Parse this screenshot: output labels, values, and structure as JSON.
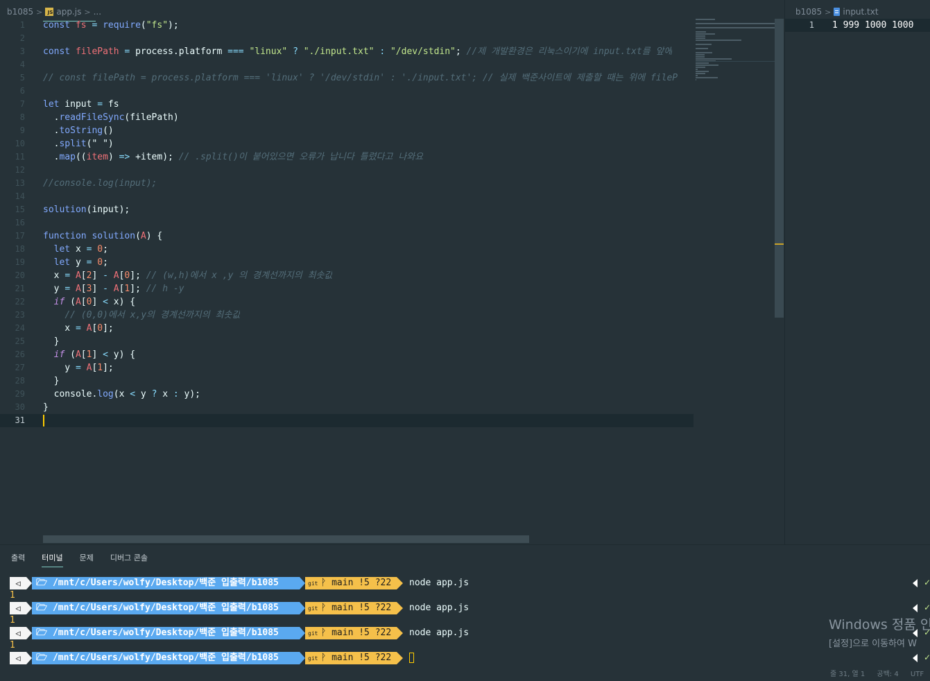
{
  "left_editor": {
    "breadcrumb": {
      "folder": "b1085",
      "file": "app.js",
      "rest": "..."
    },
    "active_line_number": "31",
    "lines": [
      {
        "n": "1",
        "tokens": [
          [
            "kw",
            "const"
          ],
          [
            "pl",
            " "
          ],
          [
            "var",
            "fs"
          ],
          [
            "pl",
            " "
          ],
          [
            "op",
            "="
          ],
          [
            "pl",
            " "
          ],
          [
            "fn",
            "require"
          ],
          [
            "pl",
            "("
          ],
          [
            "str",
            "\"fs\""
          ],
          [
            "pl",
            ");"
          ]
        ]
      },
      {
        "n": "2",
        "tokens": []
      },
      {
        "n": "3",
        "tokens": [
          [
            "kw",
            "const"
          ],
          [
            "pl",
            " "
          ],
          [
            "var",
            "filePath"
          ],
          [
            "pl",
            " "
          ],
          [
            "op",
            "="
          ],
          [
            "pl",
            " process.platform "
          ],
          [
            "op",
            "==="
          ],
          [
            "pl",
            " "
          ],
          [
            "str",
            "\"linux\""
          ],
          [
            "pl",
            " "
          ],
          [
            "op",
            "?"
          ],
          [
            "pl",
            " "
          ],
          [
            "str",
            "\"./input.txt\""
          ],
          [
            "pl",
            " "
          ],
          [
            "op",
            ":"
          ],
          [
            "pl",
            " "
          ],
          [
            "str",
            "\"/dev/stdin\""
          ],
          [
            "pl",
            "; "
          ],
          [
            "cm",
            "//제 개발환경은 리눅스이기에 input.txt를 앞에"
          ]
        ]
      },
      {
        "n": "4",
        "tokens": []
      },
      {
        "n": "5",
        "tokens": [
          [
            "cm",
            "// const filePath = process.platform === 'linux' ? '/dev/stdin' : './input.txt'; // 실제 백준사이트에 제출할 때는 위에 fileP"
          ]
        ]
      },
      {
        "n": "6",
        "tokens": []
      },
      {
        "n": "7",
        "tokens": [
          [
            "kw",
            "let"
          ],
          [
            "pl",
            " input "
          ],
          [
            "op",
            "="
          ],
          [
            "pl",
            " fs"
          ]
        ]
      },
      {
        "n": "8",
        "tokens": [
          [
            "pl",
            "  ."
          ],
          [
            "fn",
            "readFileSync"
          ],
          [
            "pl",
            "(filePath)"
          ]
        ]
      },
      {
        "n": "9",
        "tokens": [
          [
            "pl",
            "  ."
          ],
          [
            "fn",
            "toString"
          ],
          [
            "pl",
            "()"
          ]
        ]
      },
      {
        "n": "10",
        "tokens": [
          [
            "pl",
            "  ."
          ],
          [
            "fn",
            "split"
          ],
          [
            "pl",
            "(\" \")"
          ]
        ]
      },
      {
        "n": "11",
        "tokens": [
          [
            "pl",
            "  ."
          ],
          [
            "fn",
            "map"
          ],
          [
            "pl",
            "(("
          ],
          [
            "var",
            "item"
          ],
          [
            "pl",
            ") "
          ],
          [
            "op",
            "=>"
          ],
          [
            "pl",
            " +item); "
          ],
          [
            "cm",
            "// .split()이 붙어있으면 오류가 납니다 틀렸다고 나와요"
          ]
        ]
      },
      {
        "n": "12",
        "tokens": []
      },
      {
        "n": "13",
        "tokens": [
          [
            "cm",
            "//console.log(input);"
          ]
        ]
      },
      {
        "n": "14",
        "tokens": []
      },
      {
        "n": "15",
        "tokens": [
          [
            "fn",
            "solution"
          ],
          [
            "pl",
            "(input);"
          ]
        ]
      },
      {
        "n": "16",
        "tokens": []
      },
      {
        "n": "17",
        "tokens": [
          [
            "kw",
            "function"
          ],
          [
            "pl",
            " "
          ],
          [
            "fn",
            "solution"
          ],
          [
            "pl",
            "("
          ],
          [
            "var",
            "A"
          ],
          [
            "pl",
            ") {"
          ]
        ]
      },
      {
        "n": "18",
        "tokens": [
          [
            "pl",
            "  "
          ],
          [
            "kw",
            "let"
          ],
          [
            "pl",
            " x "
          ],
          [
            "op",
            "="
          ],
          [
            "pl",
            " "
          ],
          [
            "num",
            "0"
          ],
          [
            "pl",
            ";"
          ]
        ]
      },
      {
        "n": "19",
        "tokens": [
          [
            "pl",
            "  "
          ],
          [
            "kw",
            "let"
          ],
          [
            "pl",
            " y "
          ],
          [
            "op",
            "="
          ],
          [
            "pl",
            " "
          ],
          [
            "num",
            "0"
          ],
          [
            "pl",
            ";"
          ]
        ]
      },
      {
        "n": "20",
        "tokens": [
          [
            "pl",
            "  x "
          ],
          [
            "op",
            "="
          ],
          [
            "pl",
            " "
          ],
          [
            "var",
            "A"
          ],
          [
            "pl",
            "["
          ],
          [
            "num",
            "2"
          ],
          [
            "pl",
            "] "
          ],
          [
            "op",
            "-"
          ],
          [
            "pl",
            " "
          ],
          [
            "var",
            "A"
          ],
          [
            "pl",
            "["
          ],
          [
            "num",
            "0"
          ],
          [
            "pl",
            "]; "
          ],
          [
            "cm",
            "// (w,h)에서 x ,y 의 경계선까지의 최솟값"
          ]
        ]
      },
      {
        "n": "21",
        "tokens": [
          [
            "pl",
            "  y "
          ],
          [
            "op",
            "="
          ],
          [
            "pl",
            " "
          ],
          [
            "var",
            "A"
          ],
          [
            "pl",
            "["
          ],
          [
            "num",
            "3"
          ],
          [
            "pl",
            "] "
          ],
          [
            "op",
            "-"
          ],
          [
            "pl",
            " "
          ],
          [
            "var",
            "A"
          ],
          [
            "pl",
            "["
          ],
          [
            "num",
            "1"
          ],
          [
            "pl",
            "]; "
          ],
          [
            "cm",
            "// h -y"
          ]
        ]
      },
      {
        "n": "22",
        "tokens": [
          [
            "pl",
            "  "
          ],
          [
            "kw2",
            "if"
          ],
          [
            "pl",
            " ("
          ],
          [
            "var",
            "A"
          ],
          [
            "pl",
            "["
          ],
          [
            "num",
            "0"
          ],
          [
            "pl",
            "] "
          ],
          [
            "op",
            "<"
          ],
          [
            "pl",
            " x) {"
          ]
        ]
      },
      {
        "n": "23",
        "tokens": [
          [
            "pl",
            "    "
          ],
          [
            "cm",
            "// (0,0)에서 x,y의 경계선까지의 최솟값"
          ]
        ]
      },
      {
        "n": "24",
        "tokens": [
          [
            "pl",
            "    x "
          ],
          [
            "op",
            "="
          ],
          [
            "pl",
            " "
          ],
          [
            "var",
            "A"
          ],
          [
            "pl",
            "["
          ],
          [
            "num",
            "0"
          ],
          [
            "pl",
            "];"
          ]
        ]
      },
      {
        "n": "25",
        "tokens": [
          [
            "pl",
            "  }"
          ]
        ]
      },
      {
        "n": "26",
        "tokens": [
          [
            "pl",
            "  "
          ],
          [
            "kw2",
            "if"
          ],
          [
            "pl",
            " ("
          ],
          [
            "var",
            "A"
          ],
          [
            "pl",
            "["
          ],
          [
            "num",
            "1"
          ],
          [
            "pl",
            "] "
          ],
          [
            "op",
            "<"
          ],
          [
            "pl",
            " y) {"
          ]
        ]
      },
      {
        "n": "27",
        "tokens": [
          [
            "pl",
            "    y "
          ],
          [
            "op",
            "="
          ],
          [
            "pl",
            " "
          ],
          [
            "var",
            "A"
          ],
          [
            "pl",
            "["
          ],
          [
            "num",
            "1"
          ],
          [
            "pl",
            "];"
          ]
        ]
      },
      {
        "n": "28",
        "tokens": [
          [
            "pl",
            "  }"
          ]
        ]
      },
      {
        "n": "29",
        "tokens": [
          [
            "pl",
            "  console."
          ],
          [
            "fn",
            "log"
          ],
          [
            "pl",
            "(x "
          ],
          [
            "op",
            "<"
          ],
          [
            "pl",
            " y "
          ],
          [
            "op",
            "?"
          ],
          [
            "pl",
            " x "
          ],
          [
            "op",
            ":"
          ],
          [
            "pl",
            " y);"
          ]
        ]
      },
      {
        "n": "30",
        "tokens": [
          [
            "pl",
            "}"
          ]
        ]
      },
      {
        "n": "31",
        "tokens": []
      }
    ]
  },
  "right_editor": {
    "breadcrumb": {
      "folder": "b1085",
      "file": "input.txt"
    },
    "line_number": "1",
    "content": "1 999 1000 1000"
  },
  "panel": {
    "tabs": [
      {
        "label": "출력",
        "active": false
      },
      {
        "label": "터미널",
        "active": true
      },
      {
        "label": "문제",
        "active": false
      },
      {
        "label": "디버그 콘솔",
        "active": false
      }
    ],
    "terminal": {
      "os_glyph": "◁",
      "path": "🗁 /mnt/c/Users/wolfy/Desktop/백준 입출력/b1085",
      "git_label": "git",
      "branch_glyph": "ᚹ",
      "git_status": "main !5 ?22",
      "entries": [
        {
          "command": "node app.js",
          "output": "1"
        },
        {
          "command": "node app.js",
          "output": "1"
        },
        {
          "command": "node app.js",
          "output": "1"
        },
        {
          "command": "",
          "output": null
        }
      ]
    },
    "watermark": {
      "line1": "Windows 정품 인",
      "line2": "[설정]으로 이동하여 W"
    },
    "status": {
      "position": "줄 31, 열 1",
      "spaces": "공백: 4",
      "encoding": "UTF"
    }
  },
  "colors": {
    "background": "#263238",
    "cursor": "#ffcc00",
    "prompt_path": "#5aa9f0",
    "prompt_git": "#f5c04a",
    "tab_underline": "#80cbc4"
  }
}
